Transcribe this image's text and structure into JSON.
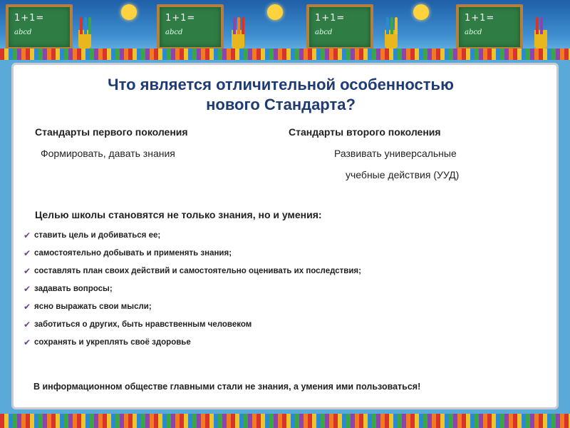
{
  "slide": {
    "title_line1": "Что является отличительной особенностью",
    "title_line2": "нового Стандарта?",
    "left_col": {
      "heading": "Стандарты  первого поколения",
      "text": "Формировать, давать знания"
    },
    "right_col": {
      "heading": "Стандарты второго поколения",
      "text_line1": "Развивать универсальные",
      "text_line2": "учебные действия (УУД)"
    },
    "goal": "Целью школы становятся не только знания, но и  умения:",
    "skills": [
      "ставить цель и добиваться ее;",
      "самостоятельно добывать и применять знания;",
      "составлять план своих действий и самостоятельно оценивать их последствия;",
      "задавать вопросы;",
      "ясно выражать свои мысли;",
      "заботиться о других, быть нравственным человеком",
      "сохранять и укреплять своё здоровье"
    ],
    "footer": "В информационном обществе главными стали не знания, а умения ими пользоваться!"
  },
  "banner": {
    "board_text": "1+1=",
    "board_text2": "abcd"
  },
  "colors": {
    "title": "#1f3b73",
    "check": "#6b3f8f",
    "board": "#2f7d45"
  }
}
